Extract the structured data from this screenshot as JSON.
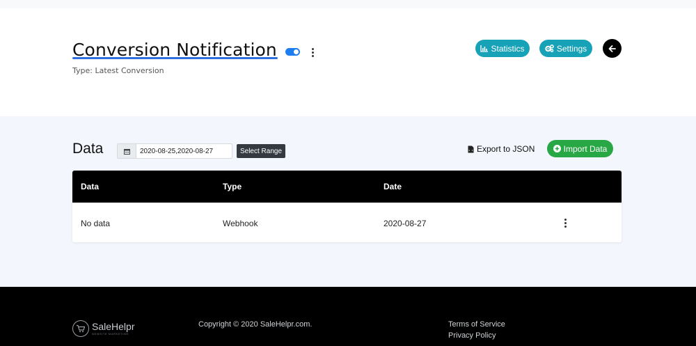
{
  "header": {
    "title": "Conversion Notification",
    "subtitle": "Type: Latest Conversion",
    "toggle_enabled": true,
    "statistics_label": "Statistics",
    "settings_label": "Settings"
  },
  "data_section": {
    "title": "Data",
    "date_range_value": "2020-08-25,2020-08-27",
    "select_range_label": "Select Range",
    "export_label": "Export to JSON",
    "import_label": "Import Data"
  },
  "table": {
    "columns": [
      "Data",
      "Type",
      "Date"
    ],
    "rows": [
      {
        "data": "No data",
        "type": "Webhook",
        "date": "2020-08-27"
      }
    ]
  },
  "footer": {
    "logo_name": "SaleHelpr",
    "logo_tagline": "WEBSITE MARKETING",
    "copyright": "Copyright © 2020 SaleHelpr.com.",
    "terms": "Terms of Service",
    "privacy": "Privacy Policy"
  },
  "colors": {
    "accent_teal": "#17a2b8",
    "success_green": "#28a745",
    "toggle_blue": "#1e7ef0",
    "title_underline": "#2f6fe0",
    "content_bg": "#f3f6fc"
  },
  "icons": [
    "chart-bar-icon",
    "cogs-icon",
    "arrow-left-icon",
    "calendar-icon",
    "file-code-icon",
    "plus-circle-icon",
    "more-vertical-icon",
    "cart-logo-icon"
  ]
}
